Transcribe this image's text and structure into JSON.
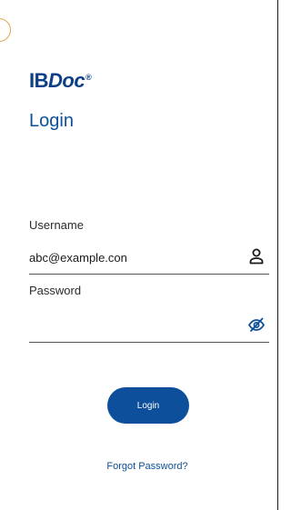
{
  "brand": {
    "logo_main": "IB",
    "logo_accent": "Doc",
    "logo_mark": "®",
    "color": "#0d3f86"
  },
  "page": {
    "title": "Login"
  },
  "form": {
    "username": {
      "label": "Username",
      "value": "abc@example.con",
      "icon": "person-icon"
    },
    "password": {
      "label": "Password",
      "value": "",
      "icon": "eye-slash-icon"
    },
    "submit_label": "Login",
    "forgot_label": "Forgot Password?"
  },
  "colors": {
    "accent": "#0d4f9a",
    "text": "#2b2b2b",
    "underline": "#555555"
  }
}
